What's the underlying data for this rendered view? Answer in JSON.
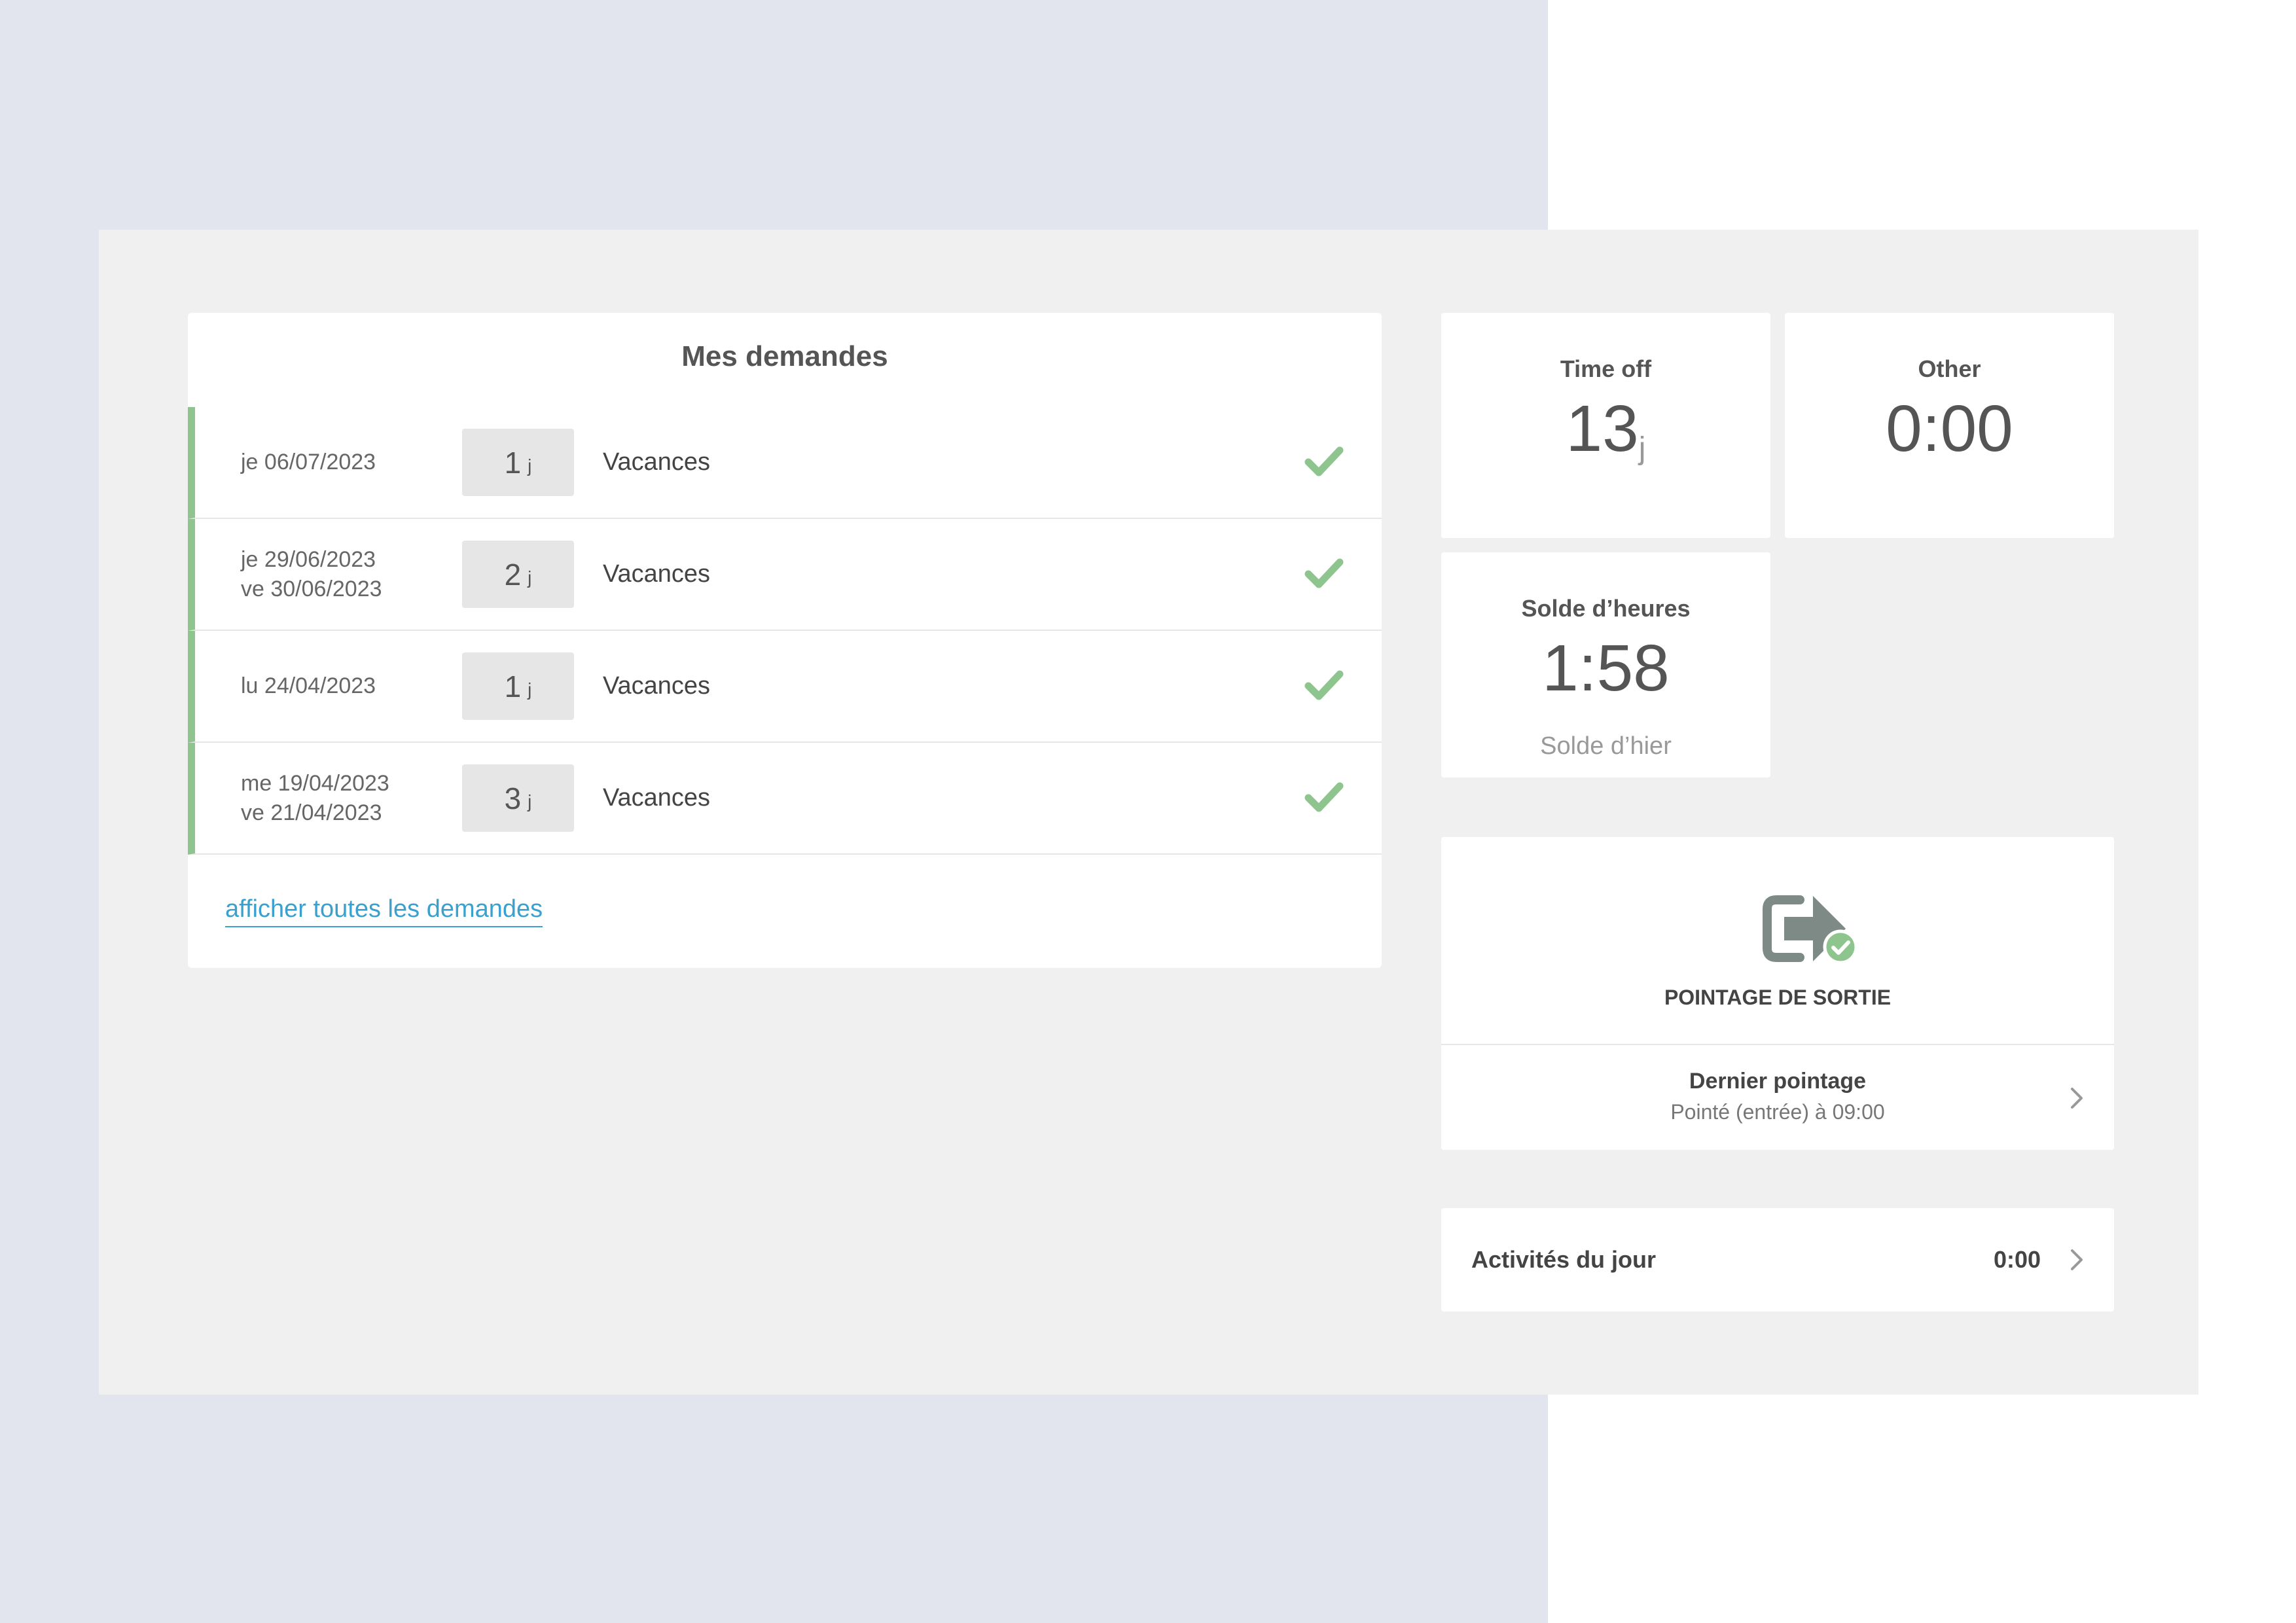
{
  "requests": {
    "title": "Mes demandes",
    "rows": [
      {
        "date1": "je 06/07/2023",
        "date2": "",
        "days": "1",
        "unit": "j",
        "type": "Vacances"
      },
      {
        "date1": "je 29/06/2023",
        "date2": "ve 30/06/2023",
        "days": "2",
        "unit": "j",
        "type": "Vacances"
      },
      {
        "date1": "lu 24/04/2023",
        "date2": "",
        "days": "1",
        "unit": "j",
        "type": "Vacances"
      },
      {
        "date1": "me 19/04/2023",
        "date2": "ve 21/04/2023",
        "days": "3",
        "unit": "j",
        "type": "Vacances"
      }
    ],
    "link": "afficher toutes les demandes"
  },
  "stats": {
    "time_off": {
      "label": "Time off",
      "value": "13",
      "unit": "j"
    },
    "other": {
      "label": "Other",
      "value": "0:00"
    },
    "balance": {
      "label": "Solde d’heures",
      "value": "1:58",
      "sub": "Solde d’hier"
    }
  },
  "clock": {
    "label": "POINTAGE DE SORTIE",
    "last_title": "Dernier pointage",
    "last_sub": "Pointé (entrée) à 09:00"
  },
  "activities": {
    "label": "Activités du jour",
    "value": "0:00"
  },
  "icons": {
    "approved": "check-icon",
    "clock_out": "clock-out-icon",
    "chevron": "chevron-right-icon"
  },
  "colors": {
    "approved_green": "#8ec58e",
    "link_blue": "#3aa1cf",
    "icon_gray": "#7d8a86"
  }
}
